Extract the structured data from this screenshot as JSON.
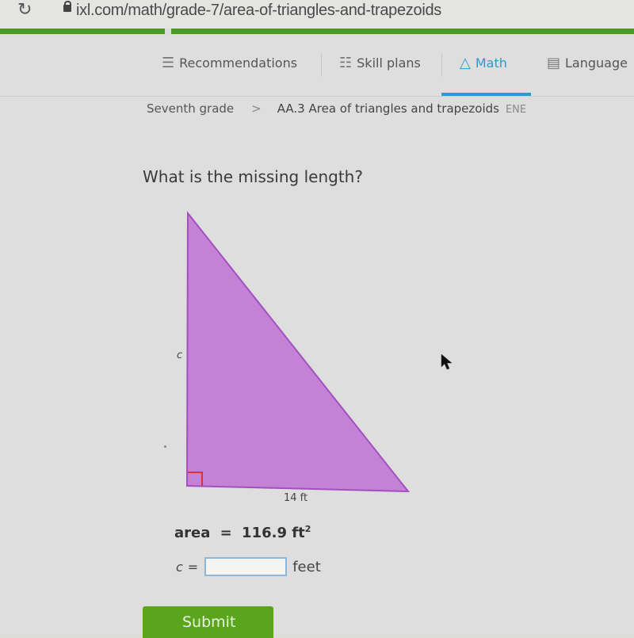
{
  "browser": {
    "url": "ixl.com/math/grade-7/area-of-triangles-and-trapezoids",
    "reload_icon": "reload-icon",
    "lock_icon": "lock-icon"
  },
  "nav": {
    "items": [
      {
        "label": "Recommendations",
        "icon": "signpost-icon",
        "active": false
      },
      {
        "label": "Skill plans",
        "icon": "clipboard-icon",
        "active": false
      },
      {
        "label": "Math",
        "icon": "pyramid-icon",
        "active": true
      },
      {
        "label": "Language",
        "icon": "book-icon",
        "active": false
      }
    ],
    "accent_color": "#2a9bd1"
  },
  "breadcrumb": {
    "grade": "Seventh grade",
    "separator": ">",
    "skill": "AA.3 Area of triangles and trapezoids",
    "code": "ENE"
  },
  "question": {
    "prompt": "What is the missing length?",
    "figure": {
      "shape": "right triangle",
      "fill_color": "#c178d6",
      "height_label": "c",
      "base_label": "14 ft"
    },
    "area_label": "area",
    "equals": "=",
    "area_value": "116.9 ft",
    "area_exponent": "2",
    "answer_variable": "c",
    "answer_value": "",
    "answer_unit": "feet"
  },
  "submit_label": "Submit",
  "submit_color": "#5aa51c"
}
